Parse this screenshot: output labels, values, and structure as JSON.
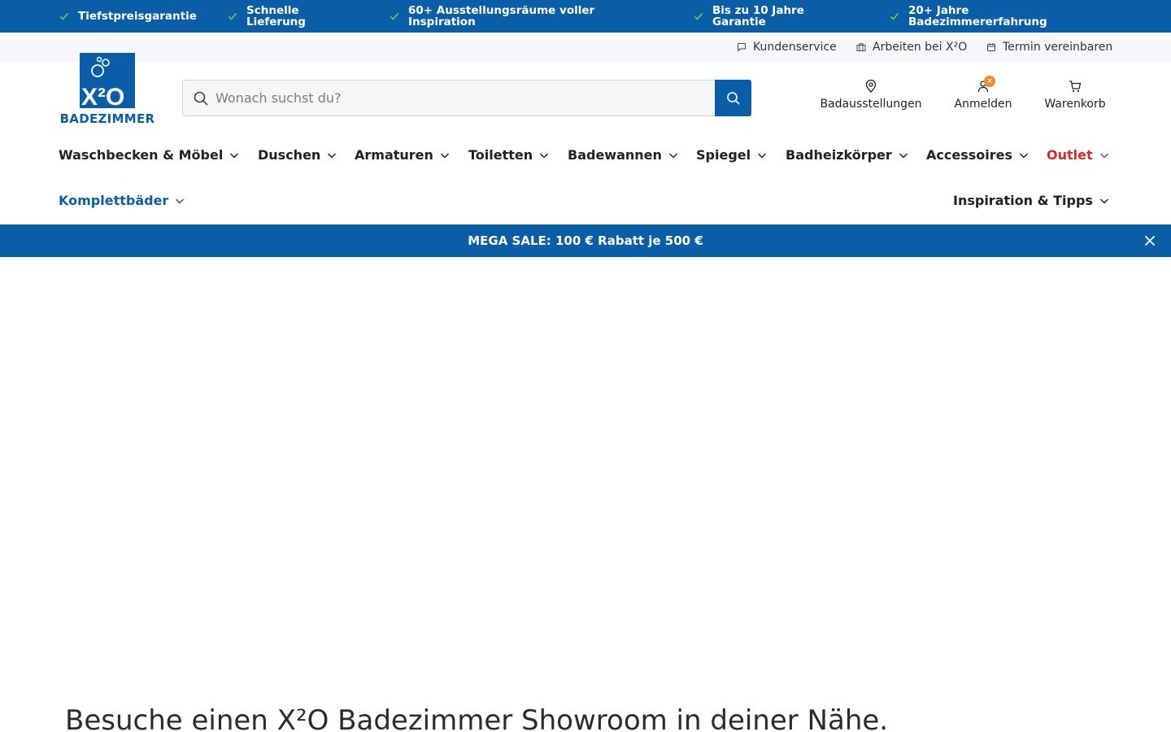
{
  "usp_bar": {
    "items": [
      {
        "line1": "Tiefstpreisgarantie",
        "line2": ""
      },
      {
        "line1": "Schnelle",
        "line2": "Lieferung"
      },
      {
        "line1": "60+ Ausstellungsräume voller",
        "line2": "Inspiration"
      },
      {
        "line1": "Bis zu 10 Jahre",
        "line2": "Garantie"
      },
      {
        "line1": "20+ Jahre",
        "line2": "Badezimmererfahrung"
      }
    ],
    "check_icon": "check-icon",
    "check_color": "#7ac943"
  },
  "service_bar": {
    "links": [
      {
        "label": "Kundenservice",
        "icon": "chat-icon"
      },
      {
        "label": "Arbeiten bei X²O",
        "icon": "briefcase-icon"
      },
      {
        "label": "Termin vereinbaren",
        "icon": "calendar-icon"
      }
    ]
  },
  "logo": {
    "mark": "X²O",
    "wordmark": "BADEZIMMER"
  },
  "search": {
    "placeholder": "Wonach suchst du?",
    "value": ""
  },
  "header_actions": [
    {
      "label": "Badausstellungen",
      "icon": "location-pin-icon"
    },
    {
      "label": "Anmelden",
      "icon": "user-icon",
      "badge": "×"
    },
    {
      "label": "Warenkorb",
      "icon": "cart-icon"
    }
  ],
  "nav": {
    "items": [
      "Waschbecken & Möbel",
      "Duschen",
      "Armaturen",
      "Toiletten",
      "Badewannen",
      "Spiegel",
      "Badheizkörper",
      "Accessoires",
      "Outlet"
    ],
    "komplett": "Komplettbäder",
    "inspiration": "Inspiration & Tipps"
  },
  "promo": {
    "text": "MEGA SALE: 100 € Rabatt je 500 €"
  },
  "main": {
    "title": "Besuche einen X²O Badezimmer Showroom in deiner Nähe."
  },
  "colors": {
    "brand_blue": "#0a5ea8",
    "outlet_red": "#d72a2a",
    "badge_orange": "#f08a24"
  }
}
